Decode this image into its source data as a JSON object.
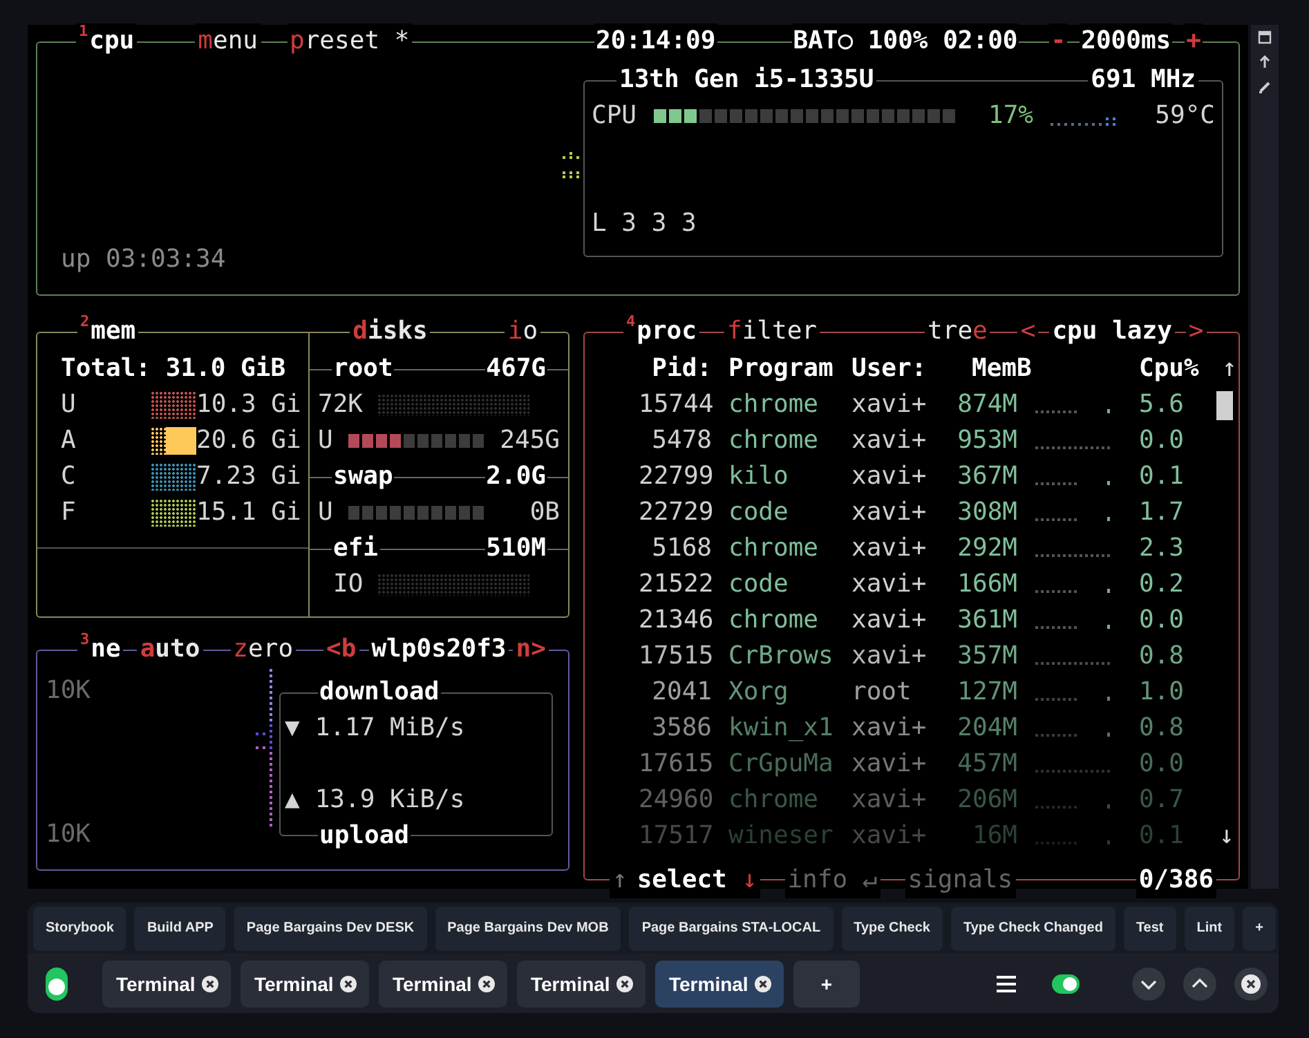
{
  "cpu_box": {
    "number": "1",
    "title": "cpu",
    "buttons": [
      {
        "hotkey": "m",
        "after": "enu"
      },
      {
        "hotkey": "p",
        "after": "reset *"
      }
    ],
    "clock": "20:14:09",
    "battery": "BAT○ 100% 02:00",
    "interval": {
      "minus": "-",
      "value": "2000ms",
      "plus": "+"
    },
    "uptime": "up 03:03:34",
    "cpu_name": "13th Gen i5-1335U",
    "frequency": "691 MHz",
    "cpu_label": "CPU",
    "cpu_meter": {
      "level": 0.15
    },
    "cpu_percent": "17%",
    "temperature": "59°C",
    "load": "L 3 3 3"
  },
  "mem_box": {
    "number": "2",
    "title": "mem",
    "total": "Total: 31.0 GiB",
    "rows": [
      {
        "label": "U",
        "value": "10.3 Gi",
        "color": "#c0504d",
        "highlighted": false
      },
      {
        "label": "A",
        "value": "20.6 Gi",
        "color": "#ffc85a",
        "highlighted": true
      },
      {
        "label": "C",
        "value": "7.23 Gi",
        "color": "#3a8fb0",
        "highlighted": false
      },
      {
        "label": "F",
        "value": "15.1 Gi",
        "color": "#a8c64a",
        "highlighted": false
      }
    ],
    "disks_button": {
      "hotkey": "d",
      "after": "isks"
    },
    "io_button": {
      "hotkey": "i",
      "after": "o"
    },
    "disks": [
      {
        "name": "root",
        "size": "467G",
        "io": "72K",
        "usage": {
          "label": "U",
          "level": 0.4,
          "value": "245G"
        }
      },
      {
        "name": "swap",
        "size": "2.0G",
        "usage": {
          "label": "U",
          "level": 0,
          "value": "0B"
        }
      },
      {
        "name": "efi",
        "size": "510M",
        "io_label": "IO"
      }
    ]
  },
  "net_box": {
    "number": "3",
    "title": "ne",
    "buttons": [
      {
        "hotkey": "a",
        "after": "uto"
      },
      {
        "hotkey": "z",
        "after": "ero"
      }
    ],
    "prev": "<b",
    "interface": "wlp0s20f3",
    "next": "n>",
    "scale_top": "10K",
    "scale_bottom": "10K",
    "download": {
      "title": "download",
      "arrow": "▼",
      "rate": "1.17 MiB/s"
    },
    "upload": {
      "title": "upload",
      "arrow": "▲",
      "rate": "13.9 KiB/s"
    }
  },
  "proc_box": {
    "number": "4",
    "title": "proc",
    "filter": {
      "hotkey": "f",
      "after": "ilter"
    },
    "tree": {
      "before": "tre",
      "hotkey": "e"
    },
    "sort": {
      "prev": "<",
      "label": "cpu lazy",
      "next": ">"
    },
    "columns": [
      "Pid:",
      "Program",
      "User:",
      "MemB",
      "Cpu%"
    ],
    "scroll_up": "↑",
    "scroll_down": "↓",
    "rows": [
      {
        "pid": "15744",
        "program": "chrome",
        "user": "xavi+",
        "mem": "874M",
        "cpu": "5.6"
      },
      {
        "pid": "5478",
        "program": "chrome",
        "user": "xavi+",
        "mem": "953M",
        "cpu": "0.0"
      },
      {
        "pid": "22799",
        "program": "kilo",
        "user": "xavi+",
        "mem": "367M",
        "cpu": "0.1"
      },
      {
        "pid": "22729",
        "program": "code",
        "user": "xavi+",
        "mem": "308M",
        "cpu": "1.7"
      },
      {
        "pid": "5168",
        "program": "chrome",
        "user": "xavi+",
        "mem": "292M",
        "cpu": "2.3"
      },
      {
        "pid": "21522",
        "program": "code",
        "user": "xavi+",
        "mem": "166M",
        "cpu": "0.2"
      },
      {
        "pid": "21346",
        "program": "chrome",
        "user": "xavi+",
        "mem": "361M",
        "cpu": "0.0"
      },
      {
        "pid": "17515",
        "program": "CrBrows",
        "user": "xavi+",
        "mem": "357M",
        "cpu": "0.8"
      },
      {
        "pid": "2041",
        "program": "Xorg",
        "user": "root",
        "mem": "127M",
        "cpu": "1.0"
      },
      {
        "pid": "3586",
        "program": "kwin_x1",
        "user": "xavi+",
        "mem": "204M",
        "cpu": "0.8"
      },
      {
        "pid": "17615",
        "program": "CrGpuMa",
        "user": "xavi+",
        "mem": "457M",
        "cpu": "0.0"
      },
      {
        "pid": "24960",
        "program": "chrome",
        "user": "xavi+",
        "mem": "206M",
        "cpu": "0.7"
      },
      {
        "pid": "17517",
        "program": "wineser",
        "user": "xavi+",
        "mem": "16M",
        "cpu": "0.1"
      }
    ],
    "footer": {
      "up": "↑",
      "select": "select",
      "down": "↓",
      "info": "info ↵",
      "signals": "signals",
      "count": "0/386"
    }
  },
  "tasks": [
    "Storybook",
    "Build APP",
    "Page Bargains Dev DESK",
    "Page Bargains Dev MOB",
    "Page Bargains STA-LOCAL",
    "Type Check",
    "Type Check Changed",
    "Test",
    "Lint",
    "+"
  ],
  "terminal_tabs": [
    {
      "label": "Terminal",
      "selected": false
    },
    {
      "label": "Terminal",
      "selected": false
    },
    {
      "label": "Terminal",
      "selected": false
    },
    {
      "label": "Terminal",
      "selected": false
    },
    {
      "label": "Terminal",
      "selected": true
    }
  ],
  "new_tab": "+",
  "sync_toggle": {
    "on": true
  }
}
